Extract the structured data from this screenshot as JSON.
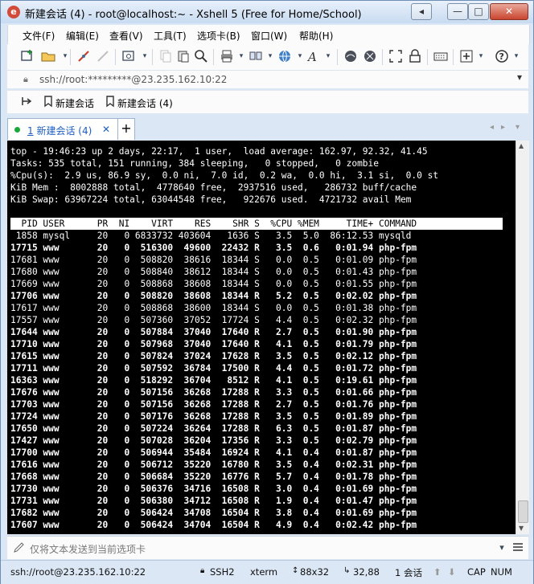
{
  "window": {
    "title": "新建会话 (4) - root@localhost:~ - Xshell 5 (Free for Home/School)",
    "app_icon_glyph": "e",
    "controls": [
      "◂",
      "—",
      "□",
      "✕"
    ]
  },
  "menu": [
    "文件(F)",
    "编辑(E)",
    "查看(V)",
    "工具(T)",
    "选项卡(B)",
    "窗口(W)",
    "帮助(H)"
  ],
  "address": {
    "value": "ssh://root:*********@23.235.162.10:22"
  },
  "links": [
    "新建会话",
    "新建会话 (4)"
  ],
  "tab": {
    "number": "1",
    "label": "新建会话 (4)",
    "close": "✕",
    "add": "+",
    "status_color": "#1aa83b"
  },
  "terminal": {
    "summary": [
      "top - 19:46:23 up 2 days, 22:17,  1 user,  load average: 162.97, 92.32, 41.45",
      "Tasks: 535 total, 151 running, 384 sleeping,   0 stopped,   0 zombie",
      "%Cpu(s):  2.9 us, 86.9 sy,  0.0 ni,  7.0 id,  0.2 wa,  0.0 hi,  3.1 si,  0.0 st",
      "KiB Mem :  8002888 total,  4778640 free,  2937516 used,   286732 buff/cache",
      "KiB Swap: 63967224 total, 63044548 free,   922676 used.  4721732 avail Mem"
    ],
    "header": "  PID USER      PR  NI    VIRT    RES    SHR S  %CPU %MEM     TIME+ COMMAND",
    "rows": [
      {
        "text": " 1858 mysql     20   0 6833732 403604   1636 S   3.5  5.0  86:12.53 mysqld",
        "bold": false
      },
      {
        "text": "17715 www       20   0  516300  49600  22432 R   3.5  0.6   0:01.94 php-fpm",
        "bold": true
      },
      {
        "text": "17681 www       20   0  508820  38616  18344 S   0.0  0.5   0:01.09 php-fpm",
        "bold": false
      },
      {
        "text": "17680 www       20   0  508840  38612  18344 S   0.0  0.5   0:01.43 php-fpm",
        "bold": false
      },
      {
        "text": "17669 www       20   0  508868  38608  18344 S   0.0  0.5   0:01.55 php-fpm",
        "bold": false
      },
      {
        "text": "17706 www       20   0  508820  38608  18344 R   5.2  0.5   0:02.02 php-fpm",
        "bold": true
      },
      {
        "text": "17617 www       20   0  508868  38600  18344 S   0.0  0.5   0:01.38 php-fpm",
        "bold": false
      },
      {
        "text": "17557 www       20   0  507360  37052  17724 S   4.4  0.5   0:02.32 php-fpm",
        "bold": false
      },
      {
        "text": "17644 www       20   0  507884  37040  17640 R   2.7  0.5   0:01.90 php-fpm",
        "bold": true
      },
      {
        "text": "17710 www       20   0  507968  37040  17640 R   4.1  0.5   0:01.79 php-fpm",
        "bold": true
      },
      {
        "text": "17615 www       20   0  507824  37024  17628 R   3.5  0.5   0:02.12 php-fpm",
        "bold": true
      },
      {
        "text": "17711 www       20   0  507592  36784  17500 R   4.4  0.5   0:01.72 php-fpm",
        "bold": true
      },
      {
        "text": "16363 www       20   0  518292  36704   8512 R   4.1  0.5   0:19.61 php-fpm",
        "bold": true
      },
      {
        "text": "17676 www       20   0  507156  36268  17288 R   3.3  0.5   0:01.66 php-fpm",
        "bold": true
      },
      {
        "text": "17703 www       20   0  507156  36268  17288 R   2.7  0.5   0:01.76 php-fpm",
        "bold": true
      },
      {
        "text": "17724 www       20   0  507176  36268  17288 R   3.5  0.5   0:01.89 php-fpm",
        "bold": true
      },
      {
        "text": "17650 www       20   0  507224  36264  17288 R   6.3  0.5   0:01.87 php-fpm",
        "bold": true
      },
      {
        "text": "17427 www       20   0  507028  36204  17356 R   3.3  0.5   0:02.79 php-fpm",
        "bold": true
      },
      {
        "text": "17700 www       20   0  506944  35484  16924 R   4.1  0.4   0:01.87 php-fpm",
        "bold": true
      },
      {
        "text": "17616 www       20   0  506712  35220  16780 R   3.5  0.4   0:02.31 php-fpm",
        "bold": true
      },
      {
        "text": "17668 www       20   0  506684  35220  16776 R   5.7  0.4   0:01.78 php-fpm",
        "bold": true
      },
      {
        "text": "17730 www       20   0  506376  34716  16508 R   3.0  0.4   0:01.69 php-fpm",
        "bold": true
      },
      {
        "text": "17731 www       20   0  506380  34712  16508 R   1.9  0.4   0:01.47 php-fpm",
        "bold": true
      },
      {
        "text": "17682 www       20   0  506424  34708  16504 R   3.8  0.4   0:01.69 php-fpm",
        "bold": true
      },
      {
        "text": "17607 www       20   0  506424  34704  16504 R   4.9  0.4   0:02.42 php-fpm",
        "bold": true
      }
    ]
  },
  "sendbar": {
    "placeholder": "仅将文本发送到当前选项卡"
  },
  "status": {
    "connection": "ssh://root@23.235.162.10:22",
    "protocol": "SSH2",
    "term": "xterm",
    "size": "88x32",
    "cursor": "32,88",
    "sessions": "1 会话",
    "caps": "CAP",
    "num": "NUM"
  }
}
